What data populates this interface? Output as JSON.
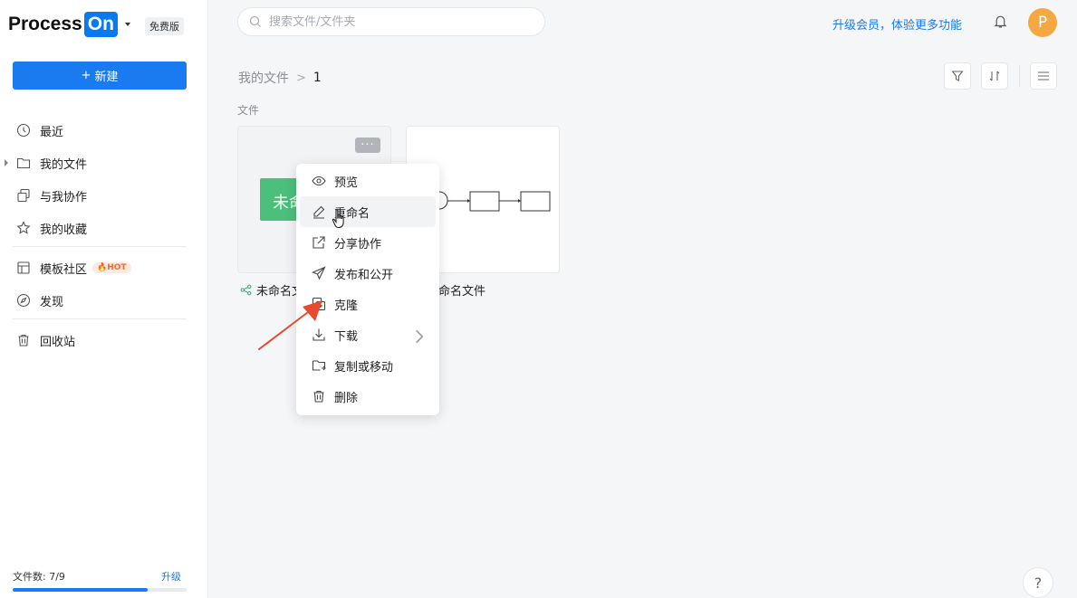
{
  "app": {
    "logo_text": "Process",
    "logo_highlight": "On",
    "plan_badge": "免费版",
    "brand_color": "#067bef"
  },
  "sidebar": {
    "new_button": "新建",
    "items": [
      {
        "label": "最近",
        "icon": "clock-icon"
      },
      {
        "label": "我的文件",
        "icon": "folder-icon",
        "expandable": true
      },
      {
        "label": "与我协作",
        "icon": "collaborate-icon"
      },
      {
        "label": "我的收藏",
        "icon": "star-icon"
      },
      {
        "label": "模板社区",
        "icon": "template-icon",
        "badge": "HOT"
      },
      {
        "label": "发现",
        "icon": "compass-icon"
      },
      {
        "label": "回收站",
        "icon": "trash-icon"
      }
    ],
    "file_count_label": "文件数: 7/9",
    "file_count_used": 7,
    "file_count_max": 9,
    "upgrade_label": "升级"
  },
  "header": {
    "search_placeholder": "搜索文件/文件夹",
    "upgrade_promo": "升级会员，体验更多功能",
    "avatar_initial": "P"
  },
  "main": {
    "breadcrumb": {
      "root": "我的文件",
      "separator": ">",
      "current": "1"
    },
    "section_label": "文件",
    "files": [
      {
        "name": "未命名文",
        "thumb_text": "未命",
        "icon": "share-icon"
      },
      {
        "name": "命名文件"
      }
    ]
  },
  "context_menu": {
    "items": [
      {
        "label": "预览",
        "icon": "eye-icon"
      },
      {
        "label": "重命名",
        "icon": "pencil-icon",
        "active": true
      },
      {
        "label": "分享协作",
        "icon": "share-out-icon"
      },
      {
        "label": "发布和公开",
        "icon": "send-icon"
      },
      {
        "label": "克隆",
        "icon": "clone-icon"
      },
      {
        "label": "下载",
        "icon": "download-icon",
        "submenu": true
      },
      {
        "label": "复制或移动",
        "icon": "move-icon"
      },
      {
        "label": "删除",
        "icon": "delete-icon"
      }
    ]
  },
  "help_label": "?",
  "colors": {
    "accent": "#1a7af0",
    "avatar": "#f5a742",
    "thumb_green": "#4cbf7c",
    "annotation_arrow": "#e84a2f"
  }
}
